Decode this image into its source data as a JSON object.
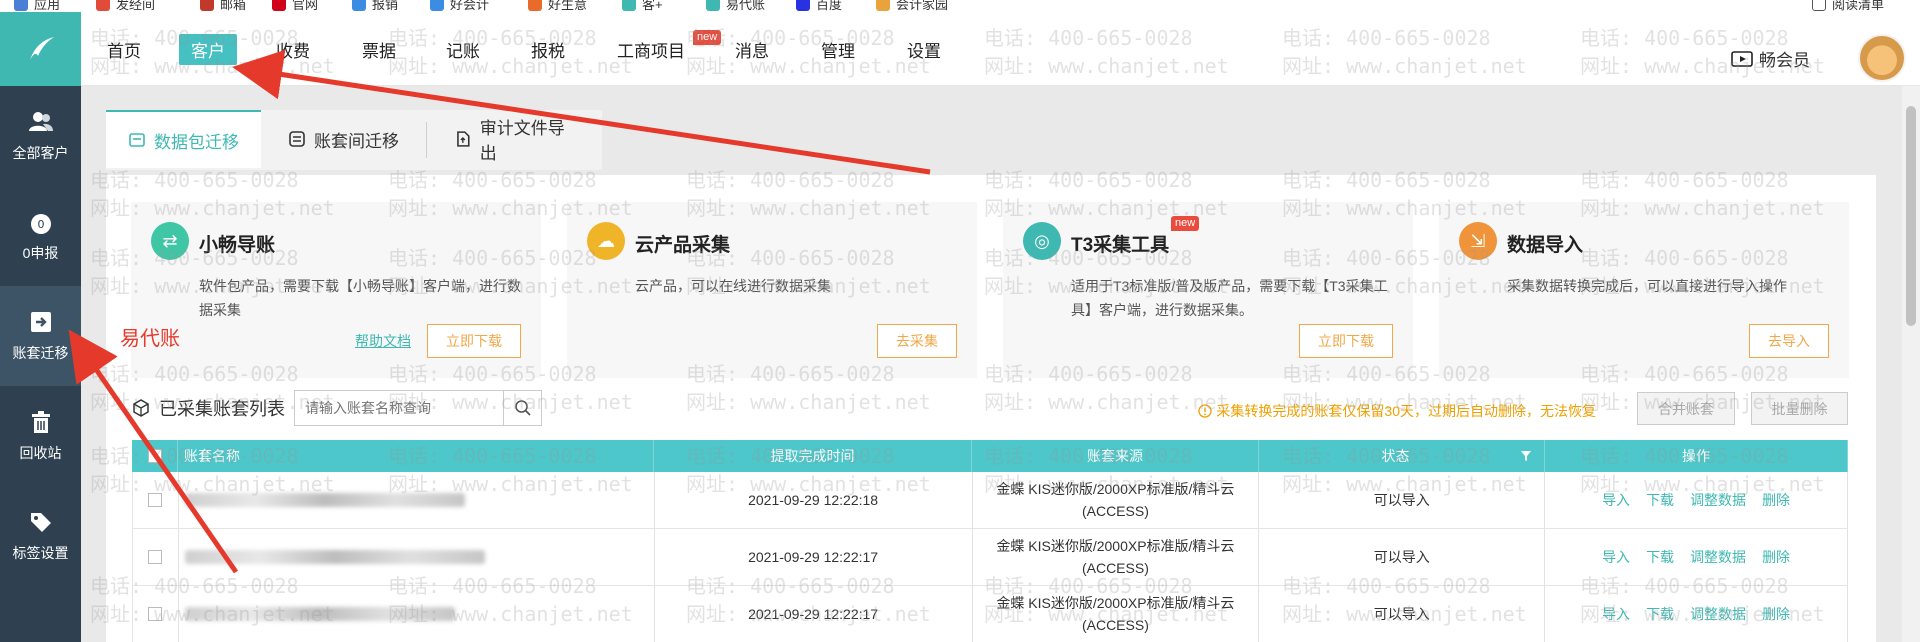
{
  "bookmarks": [
    {
      "label": "应用",
      "color": "#4a7fd6"
    },
    {
      "label": "发经间",
      "color": "#e04b3a"
    },
    {
      "label": "邮箱",
      "color": "#c0392b"
    },
    {
      "label": "官网",
      "color": "#d0021b"
    },
    {
      "label": "报销",
      "color": "#3b8de3"
    },
    {
      "label": "好会计",
      "color": "#3b8de3"
    },
    {
      "label": "好生意",
      "color": "#e86b2c"
    },
    {
      "label": "客+",
      "color": "#3fb8b2"
    },
    {
      "label": "易代账",
      "color": "#3fb8b2"
    },
    {
      "label": "百度",
      "color": "#2932e1"
    },
    {
      "label": "会计家园",
      "color": "#e8a33c"
    },
    {
      "label": "阅读清单",
      "color": "#555555"
    }
  ],
  "sidebar": [
    {
      "label": "全部客户",
      "icon": "users-icon"
    },
    {
      "label": "0申报",
      "icon": "zero-declare-icon"
    },
    {
      "label": "账套迁移",
      "icon": "migrate-icon"
    },
    {
      "label": "回收站",
      "icon": "trash-icon"
    },
    {
      "label": "标签设置",
      "icon": "tag-icon"
    }
  ],
  "nav": {
    "items": [
      "首页",
      "客户",
      "收费",
      "票据",
      "记账",
      "报税",
      "工商项目",
      "消息",
      "管理",
      "设置"
    ],
    "active": "客户",
    "new_badge": "new",
    "vip_label": "畅会员"
  },
  "tabs": [
    "数据包迁移",
    "账套间迁移",
    "审计文件导出"
  ],
  "cards": [
    {
      "title": "小畅导账",
      "desc": "软件包产品，需要下载【小畅导账】客户端，进行数据采集",
      "link": "帮助文档",
      "button": "立即下载",
      "icon_color": "#3fc6a5"
    },
    {
      "title": "云产品采集",
      "desc": "云产品，可以在线进行数据采集",
      "button": "去采集",
      "icon_color": "#f0b429"
    },
    {
      "title": "T3采集工具",
      "badge": "new",
      "desc": "适用于T3标准版/普及版产品，需要下载【T3采集工具】客户端，进行数据采集。",
      "button": "立即下载",
      "icon_color": "#3fb8b2"
    },
    {
      "title": "数据导入",
      "desc": "采集数据转换完成后，可以直接进行导入操作",
      "button": "去导入",
      "icon_color": "#f0943c"
    }
  ],
  "list": {
    "title": "已采集账套列表",
    "search_placeholder": "请输入账套名称查询",
    "notice": "采集转换完成的账套仅保留30天，过期后自动删除，无法恢复",
    "merge_btn": "合并账套",
    "batch_delete_btn": "批量删除"
  },
  "table": {
    "headers": [
      "账套名称",
      "提取完成时间",
      "账套来源",
      "状态",
      "操作"
    ],
    "rows": [
      {
        "time": "2021-09-29 12:22:18",
        "source": "金蝶 KIS迷你版/2000XP标准版/精斗云(ACCESS)",
        "status": "可以导入"
      },
      {
        "time": "2021-09-29 12:22:17",
        "source": "金蝶 KIS迷你版/2000XP标准版/精斗云(ACCESS)",
        "status": "可以导入"
      },
      {
        "time": "2021-09-29 12:22:17",
        "source": "金蝶 KIS迷你版/2000XP标准版/精斗云(ACCESS)",
        "status": "可以导入"
      }
    ],
    "actions": [
      "导入",
      "下载",
      "调整数据",
      "删除"
    ]
  },
  "watermark": {
    "phone": "电话: 400-665-0028",
    "site": "网址: www.chanjet.net"
  },
  "annotation": {
    "label": "易代账",
    "color": "#e53a2b"
  }
}
